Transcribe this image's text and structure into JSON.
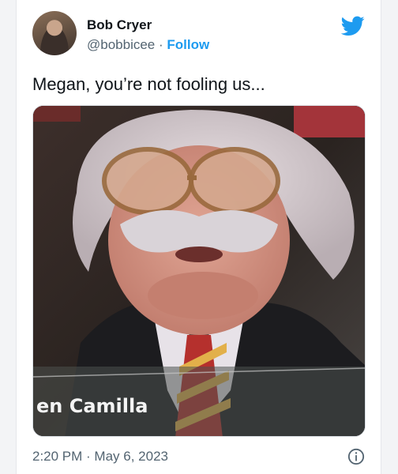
{
  "tweet": {
    "author_name": "Bob Cryer",
    "handle": "@bobbicee",
    "separator": "·",
    "follow_label": "Follow",
    "text": "Megan, you’re not fooling us...",
    "timestamp": "2:20 PM · May 6, 2023",
    "media_caption": "en Camilla"
  },
  "icons": {
    "brand": "twitter-bird-icon",
    "info": "info-icon"
  },
  "colors": {
    "accent": "#1d9bf0",
    "text_primary": "#0f1419",
    "text_secondary": "#536471"
  }
}
